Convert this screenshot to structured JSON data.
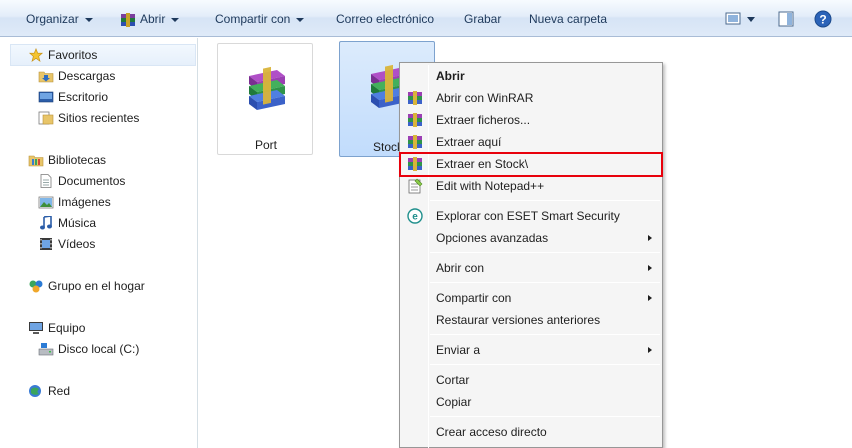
{
  "colors": {
    "highlight": "#e8000b",
    "toolbar_text": "#1e395b",
    "selection": "#c1dcfc"
  },
  "toolbar": {
    "organize": "Organizar",
    "open": "Abrir",
    "share": "Compartir con",
    "email": "Correo electrónico",
    "burn": "Grabar",
    "new_folder": "Nueva carpeta"
  },
  "sidebar": {
    "favorites": "Favoritos",
    "downloads": "Descargas",
    "desktop": "Escritorio",
    "recent": "Sitios recientes",
    "libraries": "Bibliotecas",
    "documents": "Documentos",
    "images": "Imágenes",
    "music": "Música",
    "videos": "Vídeos",
    "homegroup": "Grupo en el hogar",
    "computer": "Equipo",
    "local_disk": "Disco local (C:)",
    "network": "Red"
  },
  "files": [
    {
      "name": "Port"
    },
    {
      "name": "Stock"
    }
  ],
  "menu": {
    "open": "Abrir",
    "open_winrar": "Abrir con WinRAR",
    "extract_files": "Extraer ficheros...",
    "extract_here": "Extraer aquí",
    "extract_to": "Extraer en Stock\\",
    "notepad": "Edit with Notepad++",
    "eset": "Explorar con ESET Smart Security",
    "advanced": "Opciones avanzadas",
    "open_with": "Abrir con",
    "share_with": "Compartir con",
    "restore": "Restaurar versiones anteriores",
    "send_to": "Enviar a",
    "cut": "Cortar",
    "copy": "Copiar",
    "shortcut": "Crear acceso directo"
  }
}
